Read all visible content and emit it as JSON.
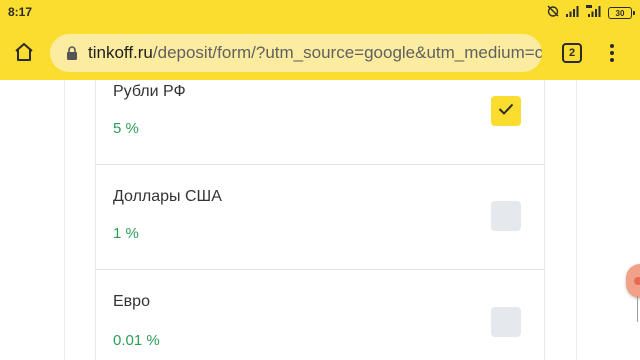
{
  "status_bar": {
    "time": "8:17",
    "battery": "30"
  },
  "browser": {
    "url_host": "tinkoff.ru",
    "url_path": "/deposit/form/?utm_source=google&utm_medium=c",
    "tab_count": "2"
  },
  "currencies": [
    {
      "name": "Рубли РФ",
      "rate": "5 %",
      "checked": true
    },
    {
      "name": "Доллары США",
      "rate": "1 %",
      "checked": false
    },
    {
      "name": "Евро",
      "rate": "0.01 %",
      "checked": false
    }
  ],
  "colors": {
    "accent": "#fadd2e",
    "rate_green": "#2d9e59",
    "checkbox_empty": "#e5e8ec"
  },
  "icons": {
    "home": "home-icon",
    "lock": "lock-icon",
    "menu": "more-vert-icon",
    "check": "check-icon"
  }
}
